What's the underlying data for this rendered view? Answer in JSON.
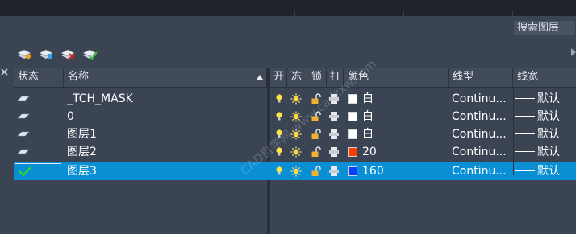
{
  "search": {
    "placeholder": "搜索图层"
  },
  "toolbar": {
    "buttons": [
      {
        "icon": "new-layer-icon"
      },
      {
        "icon": "new-layer-vp-frozen-icon"
      },
      {
        "icon": "delete-layer-icon"
      },
      {
        "icon": "set-current-layer-icon"
      }
    ]
  },
  "table": {
    "headers": {
      "status": "状态",
      "name": "名称",
      "on": "开",
      "freeze": "冻",
      "lock": "锁",
      "plot": "打",
      "color": "颜色",
      "linetype": "线型",
      "lineweight": "线宽"
    },
    "rows": [
      {
        "name": "_TCH_MASK",
        "color_label": "白",
        "color_hex": "#ffffff",
        "linetype": "Continu...",
        "lineweight": "默认",
        "current": false
      },
      {
        "name": "0",
        "color_label": "白",
        "color_hex": "#ffffff",
        "linetype": "Continu...",
        "lineweight": "默认",
        "current": false
      },
      {
        "name": "图层1",
        "color_label": "白",
        "color_hex": "#ffffff",
        "linetype": "Continu...",
        "lineweight": "默认",
        "current": false
      },
      {
        "name": "图层2",
        "color_label": "20",
        "color_hex": "#ff3f00",
        "linetype": "Continu...",
        "lineweight": "默认",
        "current": false
      },
      {
        "name": "图层3",
        "color_label": "160",
        "color_hex": "#0a3fff",
        "linetype": "Continu...",
        "lineweight": "默认",
        "current": true
      }
    ]
  },
  "watermark": "CAD自学网 www.cadzxw.com",
  "colors": {
    "selection": "#0a8fd4",
    "panel": "#3b4453",
    "header": "#404a59"
  }
}
